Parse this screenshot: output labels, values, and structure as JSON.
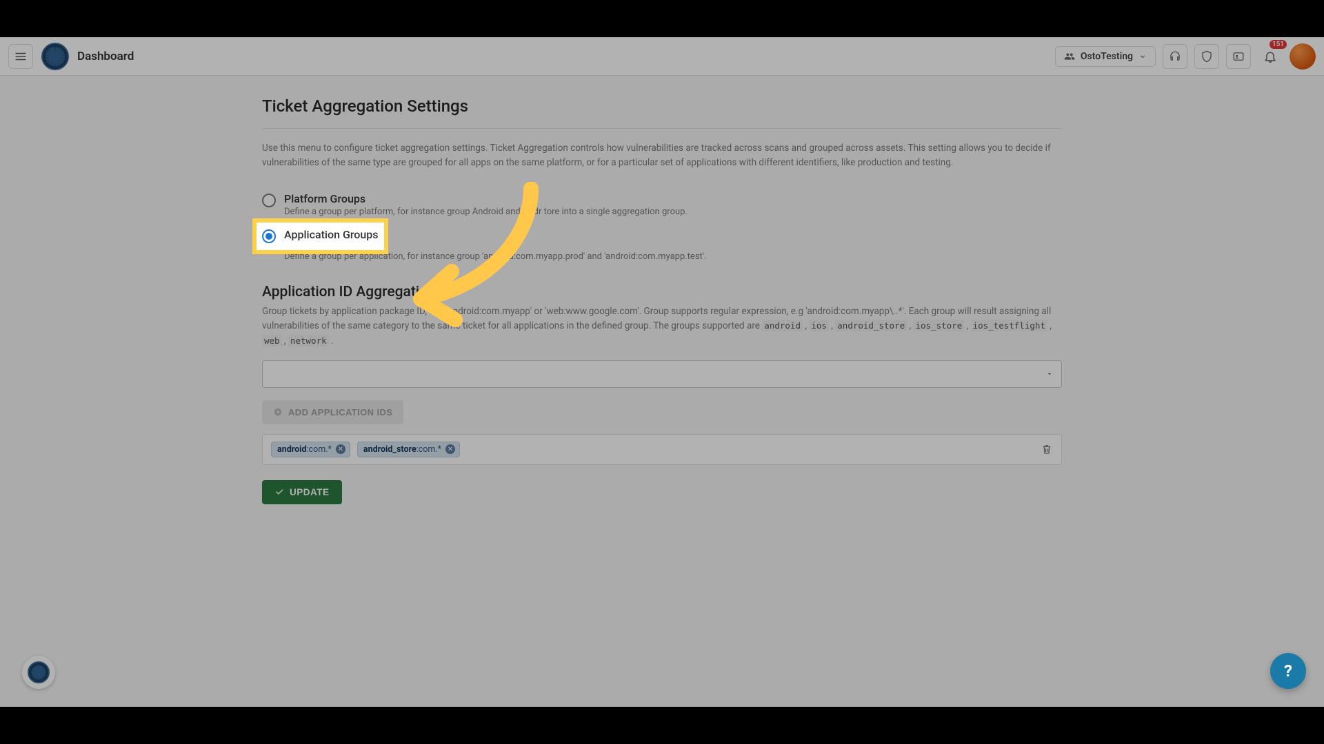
{
  "header": {
    "title": "Dashboard",
    "org_label": "OstoTesting",
    "notification_count": "151"
  },
  "page": {
    "section_title": "Ticket Aggregation Settings",
    "description": "Use this menu to configure ticket aggregation settings. Ticket Aggregation controls how vulnerabilities are tracked across scans and grouped across assets. This setting allows you to decide if vulnerabilities of the same type are grouped for all apps on the same platform, or for a particular set of applications with different identifiers, like production and testing.",
    "radios": {
      "platform": {
        "label": "Platform Groups",
        "sub": "Define a group per platform, for instance group Android            and Andr        tore into a single aggregation group."
      },
      "application": {
        "label": "Application Groups",
        "sub": "Define a group per application, for instance group 'android:com.myapp.prod' and 'android:com.myapp.test'."
      }
    },
    "sub_section": {
      "title": "Application ID Aggregation",
      "desc_pre": "Group tickets by application package ID, e.g. 'android:com.myapp' or 'web:www.google.com'. Group supports regular expression, e.g 'android:com.myapp\\..*'. Each group will result assigning all vulnerabilities of the same category to the same ticket for all applications in the defined group. The groups supported are ",
      "supported": [
        "android",
        "ios",
        "android_store",
        "ios_store",
        "ios_testflight",
        "web",
        "network"
      ]
    },
    "add_button": "ADD APPLICATION IDS",
    "chips": [
      {
        "prefix": "android",
        "suffix": ":com.*"
      },
      {
        "prefix": "android_store",
        "suffix": ":com.*"
      }
    ],
    "update_button": "UPDATE"
  }
}
